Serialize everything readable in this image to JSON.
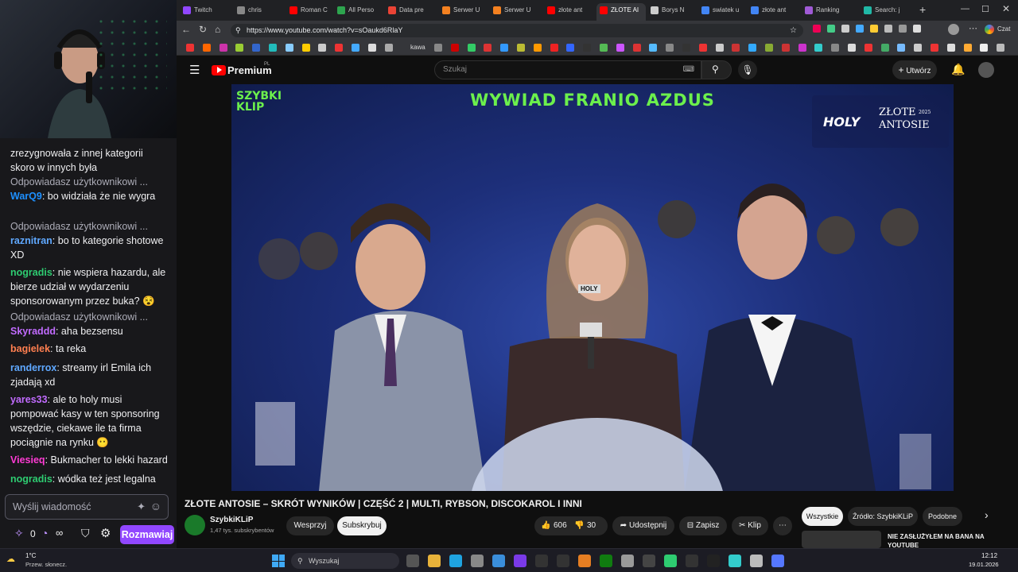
{
  "browser": {
    "tabs": [
      {
        "label": "Twitch",
        "color": "#9147ff"
      },
      {
        "label": "chris",
        "color": "#888888"
      },
      {
        "label": "Roman C",
        "color": "#ff0000"
      },
      {
        "label": "All Perso",
        "color": "#2da44e"
      },
      {
        "label": "Data pre",
        "color": "#ea4335"
      },
      {
        "label": "Serwer U",
        "color": "#f48120"
      },
      {
        "label": "Serwer U",
        "color": "#f48120"
      },
      {
        "label": "złote ant",
        "color": "#ff0000"
      },
      {
        "label": "ZŁOTE AI",
        "color": "#ff0000"
      },
      {
        "label": "Borys N",
        "color": "#cccccc"
      },
      {
        "label": "swiatek u",
        "color": "#4285f4"
      },
      {
        "label": "złote ant",
        "color": "#4285f4"
      },
      {
        "label": "Ranking",
        "color": "#a05ad6"
      },
      {
        "label": "Search: j",
        "color": "#20b8a6"
      }
    ],
    "url": "https://www.youtube.com/watch?v=sOaukd6RlaY",
    "bookmark_text": "kawa",
    "profile_label": "Czat"
  },
  "chat": {
    "messages": [
      {
        "user": "",
        "text": "zrezygnowała z innej kategorii skoro w innych była",
        "reply": "",
        "color": "#efeff1"
      },
      {
        "reply": "Odpowiadasz użytkownikowi ...",
        "user": "WarQ9",
        "text": ": bo widziała że nie wygra",
        "color": "#1e90ff"
      },
      {
        "reply": "Odpowiadasz użytkownikowi ...",
        "user": "raznitran",
        "text": ": bo to kategorie shotowe XD",
        "color": "#5fa8ff"
      },
      {
        "reply": "",
        "user": "nogradis",
        "text": ": nie wspiera hazardu, ale bierze udział w wydarzeniu sponsorowanym przez buka? 😵",
        "color": "#2ecc71"
      },
      {
        "reply": "Odpowiadasz użytkownikowi ...",
        "user": "Skyraddd",
        "text": ": aha bezsensu",
        "color": "#c16bff"
      },
      {
        "reply": "",
        "user": "bagielek",
        "text": ": ta reka",
        "color": "#ff7f50"
      },
      {
        "reply": "",
        "user": "randerrox",
        "text": ": streamy irl Emila ich zjadają xd",
        "color": "#5fa8ff"
      },
      {
        "reply": "",
        "user": "yares33",
        "text": ": ale to holy musi pompować kasy w ten sponsoring wszędzie, ciekawe ile ta firma pociągnie na rynku 😶",
        "color": "#c16bff"
      },
      {
        "reply": "",
        "user": "Viesieq",
        "text": ": Bukmacher to lekki hazard",
        "color": "#ff3bd4"
      },
      {
        "reply": "",
        "user": "nogradis",
        "text": ": wódka też jest legalna",
        "color": "#2ecc71"
      }
    ],
    "input_placeholder": "Wyślij wiadomość",
    "points": "0",
    "infinity": "∞",
    "send_button": "Rozmawiaj"
  },
  "youtube": {
    "brand": "Premium",
    "brand_region": "PL",
    "search_placeholder": "Szukaj",
    "create_button": "Utwórz",
    "video_overlay_title": "WYWIAD FRANIO AZDUS",
    "video_logo_line1": "SZYBKI",
    "video_logo_line2": "KLIP",
    "event_sponsor": "HOLY",
    "event_name": "ZŁOTE ANTOSIE",
    "event_year": "2025",
    "mic_label": "HOLY",
    "video_title": "ZŁOTE ANTOSIE – SKRÓT WYNIKÓW | CZĘŚĆ 2 | MULTI, RYBSON, DISCOKAROL I INNI",
    "channel_name": "SzybkiKLiP",
    "subscribers": "1,47 tys. subskrybentów",
    "support_button": "Wesprzyj",
    "subscribe_button": "Subskrybuj",
    "likes": "606",
    "dislikes": "30",
    "share": "Udostępnij",
    "save": "Zapisz",
    "clip": "Klip",
    "chips": [
      "Wszystkie",
      "Źródło: SzybkiKLiP",
      "Podobne"
    ],
    "rec_title_line1": "NIE ZASŁUŻYŁEM NA BANA NA",
    "rec_title_line2": "YOUTUBE"
  },
  "taskbar": {
    "weather_temp": "1°C",
    "weather_desc": "Przew. słonecz.",
    "search_placeholder": "Wyszukaj",
    "time": "12:12",
    "date": "19.01.2026"
  }
}
